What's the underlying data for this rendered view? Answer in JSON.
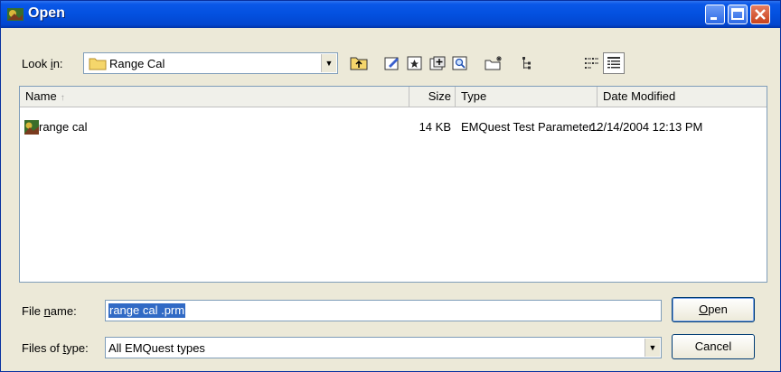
{
  "window": {
    "title": "Open"
  },
  "look_in": {
    "label_before": "Look ",
    "label_accel": "i",
    "label_after": "n:",
    "value": "Range Cal"
  },
  "toolbar": {
    "icons": [
      "up-folder-icon",
      "edit-icon",
      "favorites-icon",
      "add-icon",
      "search-icon",
      "new-folder-icon",
      "tree-icon",
      "list-view-icon",
      "details-view-icon"
    ]
  },
  "list": {
    "columns": {
      "name": "Name",
      "size": "Size",
      "type": "Type",
      "date": "Date Modified"
    },
    "rows": [
      {
        "name": "range cal",
        "size": "14 KB",
        "type": "EMQuest Test Parameter...",
        "date": "12/14/2004 12:13 PM"
      }
    ]
  },
  "file_name": {
    "label_before": "File ",
    "label_accel": "n",
    "label_after": "ame:",
    "value": "range cal .prm"
  },
  "files_of_type": {
    "label_before": "Files of ",
    "label_accel": "t",
    "label_after": "ype:",
    "value": "All EMQuest types"
  },
  "buttons": {
    "open_accel": "O",
    "open_rest": "pen",
    "cancel": "Cancel"
  },
  "colors": {
    "titlebar": "#0350df",
    "selection": "#316ac5",
    "window_bg": "#ece9d8"
  }
}
